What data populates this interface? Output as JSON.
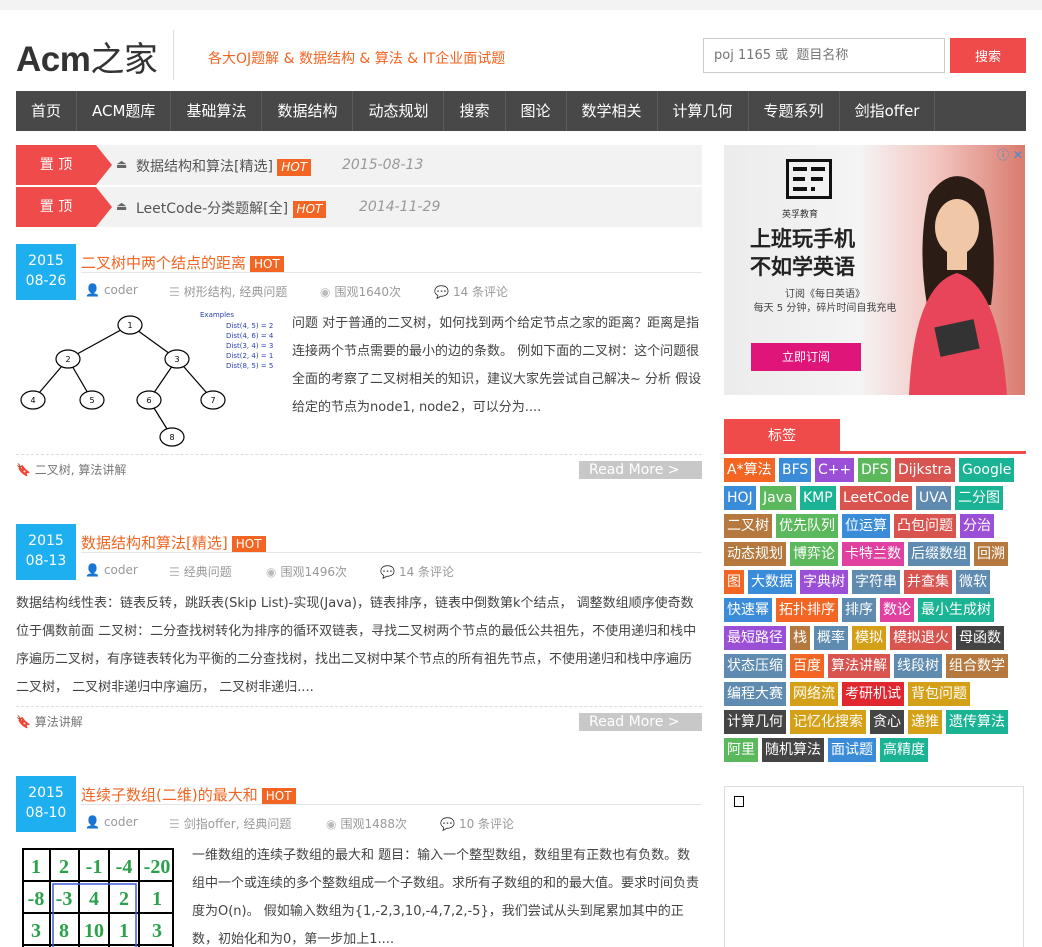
{
  "header": {
    "logo_en": "Acm",
    "logo_cn": "之家",
    "tagline": "各大OJ题解 & 数据结构 & 算法 & IT企业面试题",
    "search_placeholder": "poj 1165 或  题目名称",
    "search_button": "搜索"
  },
  "nav": [
    "首页",
    "ACM题库",
    "基础算法",
    "数据结构",
    "动态规划",
    "搜索",
    "图论",
    "数学相关",
    "计算几何",
    "专题系列",
    "剑指offer"
  ],
  "sticky": [
    {
      "badge": "置 顶",
      "title": "数据结构和算法[精选]",
      "hot": "HOT",
      "date": "2015-08-13"
    },
    {
      "badge": "置 顶",
      "title": "LeetCode-分类题解[全]",
      "hot": "HOT",
      "date": "2014-11-29"
    }
  ],
  "articles": [
    {
      "year": "2015",
      "day": "08-26",
      "title": "二叉树中两个结点的距离",
      "hot": "HOT",
      "author": "coder",
      "category": "树形结构, 经典问题",
      "views": "围观1640次",
      "comments": "14 条评论",
      "excerpt": "问题 对于普通的二叉树，如何找到两个给定节点之家的距离？距离是指连接两个节点需要的最小的边的条数。 例如下面的二叉树：这个问题很全面的考察了二叉树相关的知识，建议大家先尝试自己解决~ 分析 假设给定的节点为node1, node2，可以分为....",
      "tags": "二叉树, 算法讲解",
      "read_more": "Read More >",
      "figure": {
        "examples_title": "Examples",
        "examples": [
          "Dist(4, 5)  = 2",
          "Dist(4, 6)  = 4",
          "Dist(3, 4)  = 3",
          "Dist(2, 4)  = 1",
          "Dist(8, 5)  = 5"
        ],
        "nodes": [
          "1",
          "2",
          "3",
          "4",
          "5",
          "6",
          "7",
          "8"
        ]
      }
    },
    {
      "year": "2015",
      "day": "08-13",
      "title": "数据结构和算法[精选]",
      "hot": "HOT",
      "author": "coder",
      "category": "经典问题",
      "views": "围观1496次",
      "comments": "14 条评论",
      "excerpt": "数据结构线性表：链表反转，跳跃表(Skip List)-实现(Java)，链表排序，链表中倒数第k个结点， 调整数组顺序使奇数位于偶数前面 二叉树：二分查找树转化为排序的循环双链表，寻找二叉树两个节点的最低公共祖先，不使用递归和栈中序遍历二叉树，有序链表转化为平衡的二分查找树，找出二叉树中某个节点的所有祖先节点，不使用递归和栈中序遍历二叉树， 二叉树非递归中序遍历， 二叉树非递归....",
      "tags": "算法讲解",
      "read_more": "Read More >"
    },
    {
      "year": "2015",
      "day": "08-10",
      "title": "连续子数组(二维)的最大和",
      "hot": "HOT",
      "author": "coder",
      "category": "剑指offer, 经典问题",
      "views": "围观1488次",
      "comments": "10 条评论",
      "excerpt": "一维数组的连续子数组的最大和 题目：输入一个整型数组，数组里有正数也有负数。数组中一个或连续的多个整数组成一个子数组。求所有子数组的和的最大值。要求时间负责度为O(n)。 假如输入数组为{1,-2,3,10,-4,7,2,-5}，我们尝试从头到尾累加其中的正数，初始化和为0，第一步加上1....",
      "grid": [
        [
          "1",
          "2",
          "-1",
          "-4",
          "-20"
        ],
        [
          "-8",
          "-3",
          "4",
          "2",
          "1"
        ],
        [
          "3",
          "8",
          "10",
          "1",
          "3"
        ]
      ]
    }
  ],
  "ad": {
    "brand": "英孚教育",
    "headline_1": "上班玩手机",
    "headline_2": "不如学英语",
    "sub_1": "订阅《每日英语》",
    "sub_2": "每天 5 分钟，碎片时间自我充电",
    "button": "立即订阅"
  },
  "tag_section": {
    "title": "标签",
    "tags": [
      {
        "label": "A*算法",
        "color": "#f26522"
      },
      {
        "label": "BFS",
        "color": "#3b8cd8"
      },
      {
        "label": "C++",
        "color": "#9b4fd6"
      },
      {
        "label": "DFS",
        "color": "#5cb85c"
      },
      {
        "label": "Dijkstra",
        "color": "#d9534f"
      },
      {
        "label": "Google",
        "color": "#1ab394"
      },
      {
        "label": "HOJ",
        "color": "#3b8cd8"
      },
      {
        "label": "Java",
        "color": "#5cb85c"
      },
      {
        "label": "KMP",
        "color": "#1ab394"
      },
      {
        "label": "LeetCode",
        "color": "#d9534f"
      },
      {
        "label": "UVA",
        "color": "#5f8bb0"
      },
      {
        "label": "二分图",
        "color": "#1ab394"
      },
      {
        "label": "二叉树",
        "color": "#b5793f"
      },
      {
        "label": "优先队列",
        "color": "#5cb85c"
      },
      {
        "label": "位运算",
        "color": "#3b8cd8"
      },
      {
        "label": "凸包问题",
        "color": "#d9534f"
      },
      {
        "label": "分治",
        "color": "#9b4fd6"
      },
      {
        "label": "动态规划",
        "color": "#b5793f"
      },
      {
        "label": "博弈论",
        "color": "#5cb85c"
      },
      {
        "label": "卡特兰数",
        "color": "#e040a0"
      },
      {
        "label": "后缀数组",
        "color": "#5f8bb0"
      },
      {
        "label": "回溯",
        "color": "#b5793f"
      },
      {
        "label": "图",
        "color": "#f26522"
      },
      {
        "label": "大数据",
        "color": "#3b8cd8"
      },
      {
        "label": "字典树",
        "color": "#9b4fd6"
      },
      {
        "label": "字符串",
        "color": "#5f8bb0"
      },
      {
        "label": "并查集",
        "color": "#d9534f"
      },
      {
        "label": "微软",
        "color": "#5f8bb0"
      },
      {
        "label": "快速幂",
        "color": "#3b8cd8"
      },
      {
        "label": "拓扑排序",
        "color": "#f26522"
      },
      {
        "label": "排序",
        "color": "#5f8bb0"
      },
      {
        "label": "数论",
        "color": "#e040a0"
      },
      {
        "label": "最小生成树",
        "color": "#1ab394"
      },
      {
        "label": "最短路径",
        "color": "#9b4fd6"
      },
      {
        "label": "栈",
        "color": "#b5793f"
      },
      {
        "label": "概率",
        "color": "#5f8bb0"
      },
      {
        "label": "模拟",
        "color": "#d4a017"
      },
      {
        "label": "模拟退火",
        "color": "#d9534f"
      },
      {
        "label": "母函数",
        "color": "#444444"
      },
      {
        "label": "状态压缩",
        "color": "#5f8bb0"
      },
      {
        "label": "百度",
        "color": "#f26522"
      },
      {
        "label": "算法讲解",
        "color": "#d9534f"
      },
      {
        "label": "线段树",
        "color": "#5f8bb0"
      },
      {
        "label": "组合数学",
        "color": "#b5793f"
      },
      {
        "label": "编程大赛",
        "color": "#5f8bb0"
      },
      {
        "label": "网络流",
        "color": "#d4a017"
      },
      {
        "label": "考研机试",
        "color": "#e0262f"
      },
      {
        "label": "背包问题",
        "color": "#d4a017"
      },
      {
        "label": "计算几何",
        "color": "#444444"
      },
      {
        "label": "记忆化搜索",
        "color": "#d4a017"
      },
      {
        "label": "贪心",
        "color": "#444444"
      },
      {
        "label": "递推",
        "color": "#d4a017"
      },
      {
        "label": "遗传算法",
        "color": "#1ab394"
      },
      {
        "label": "阿里",
        "color": "#5cb85c"
      },
      {
        "label": "随机算法",
        "color": "#444444"
      },
      {
        "label": "面试题",
        "color": "#3b8cd8"
      },
      {
        "label": "高精度",
        "color": "#1ab394"
      }
    ]
  }
}
